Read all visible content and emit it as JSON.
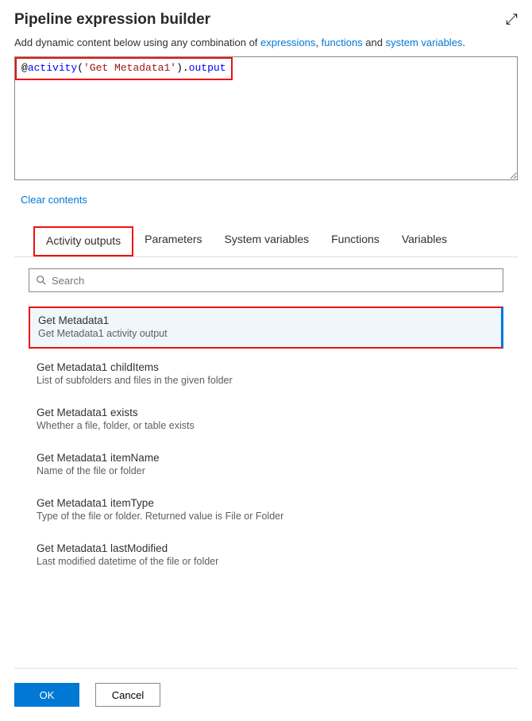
{
  "header": {
    "title": "Pipeline expression builder"
  },
  "intro": {
    "prefix": "Add dynamic content below using any combination of ",
    "link1": "expressions",
    "comma": ", ",
    "link2": "functions",
    "and": " and ",
    "link3": "system variables",
    "suffix": "."
  },
  "expression": {
    "raw": "@activity('Get Metadata1').output",
    "at": "@",
    "kw": "activity",
    "lpar": "(",
    "str": "'Get Metadata1'",
    "rpar": ").",
    "tail": "output"
  },
  "clear_label": "Clear contents",
  "tabs": [
    {
      "label": "Activity outputs",
      "active": true
    },
    {
      "label": "Parameters"
    },
    {
      "label": "System variables"
    },
    {
      "label": "Functions"
    },
    {
      "label": "Variables"
    }
  ],
  "search": {
    "placeholder": "Search"
  },
  "items": [
    {
      "title": "Get Metadata1",
      "desc": "Get Metadata1 activity output",
      "selected": true
    },
    {
      "title": "Get Metadata1 childItems",
      "desc": "List of subfolders and files in the given folder"
    },
    {
      "title": "Get Metadata1 exists",
      "desc": "Whether a file, folder, or table exists"
    },
    {
      "title": "Get Metadata1 itemName",
      "desc": "Name of the file or folder"
    },
    {
      "title": "Get Metadata1 itemType",
      "desc": "Type of the file or folder. Returned value is File or Folder"
    },
    {
      "title": "Get Metadata1 lastModified",
      "desc": "Last modified datetime of the file or folder"
    }
  ],
  "footer": {
    "ok": "OK",
    "cancel": "Cancel"
  }
}
